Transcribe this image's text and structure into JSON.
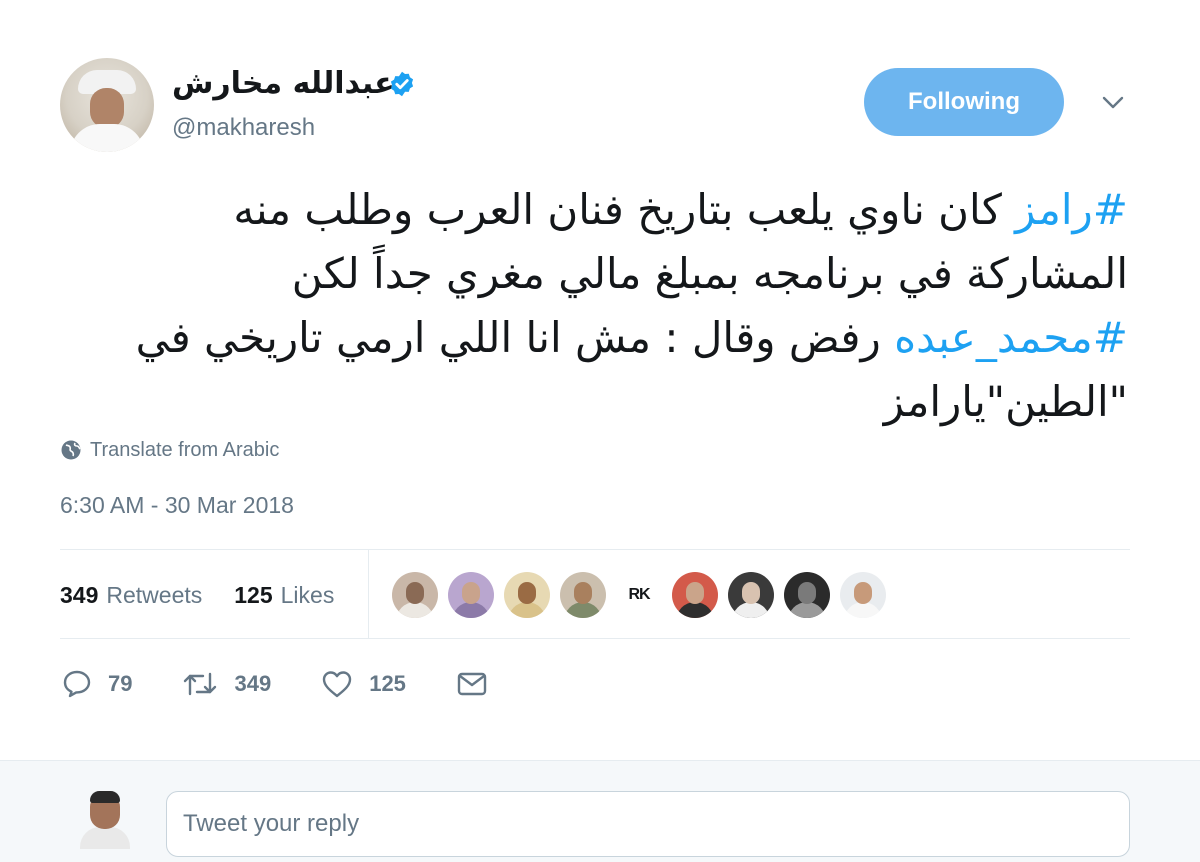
{
  "author": {
    "display_name": "عبدالله مخارش",
    "username": "@makharesh",
    "verified": true
  },
  "follow_button": {
    "label": "Following"
  },
  "tweet": {
    "parts": [
      {
        "type": "hashtag",
        "text": "#رامز"
      },
      {
        "type": "text",
        "text": " كان ناوي يلعب بتاريخ فنان العرب وطلب منه المشاركة في برنامجه بمبلغ مالي مغري جداً لكن "
      },
      {
        "type": "hashtag",
        "text": "#محمد_عبده"
      },
      {
        "type": "text",
        "text": " رفض وقال : مش انا اللي ارمي تاريخي في \"الطين\"يارامز"
      }
    ],
    "translate_label": "Translate from Arabic",
    "timestamp": "6:30 AM - 30 Mar 2018"
  },
  "stats": {
    "retweets_count": "349",
    "retweets_label": "Retweets",
    "likes_count": "125",
    "likes_label": "Likes"
  },
  "liker_avatars": [
    {
      "kind": "photo",
      "bg": "#c9b7a8",
      "face": "#8a6a55",
      "body": "#ece8e2"
    },
    {
      "kind": "photo",
      "bg": "#b9a6cf",
      "face": "#c9a38c",
      "body": "#8c7aa8"
    },
    {
      "kind": "photo",
      "bg": "#e7d9b3",
      "face": "#9a6b44",
      "body": "#d9c28a"
    },
    {
      "kind": "photo",
      "bg": "#cbbfae",
      "face": "#a9805e",
      "body": "#7e8a6a"
    },
    {
      "kind": "badge",
      "text": "RK"
    },
    {
      "kind": "photo",
      "bg": "#d35a4a",
      "face": "#caa48a",
      "body": "#2e2e2e"
    },
    {
      "kind": "photo",
      "bg": "#3a3a3a",
      "face": "#d8c2b0",
      "body": "#efefef"
    },
    {
      "kind": "photo",
      "bg": "#2b2b2b",
      "face": "#7a7a7a",
      "body": "#9a9a9a"
    },
    {
      "kind": "photo",
      "bg": "#e9ecef",
      "face": "#c79a7a",
      "body": "#f7f7f7"
    }
  ],
  "actions": {
    "reply_count": "79",
    "retweet_count": "349",
    "like_count": "125"
  },
  "icons": {
    "verified": "verified-badge-icon",
    "caret": "chevron-down-icon",
    "globe": "globe-icon",
    "reply": "reply-icon",
    "retweet": "retweet-icon",
    "like": "heart-icon",
    "dm": "envelope-icon"
  },
  "colors": {
    "accent": "#1da1f2",
    "follow_button": "#6db5ef",
    "muted": "#657786",
    "text": "#14171a"
  },
  "reply": {
    "placeholder": "Tweet your reply"
  }
}
